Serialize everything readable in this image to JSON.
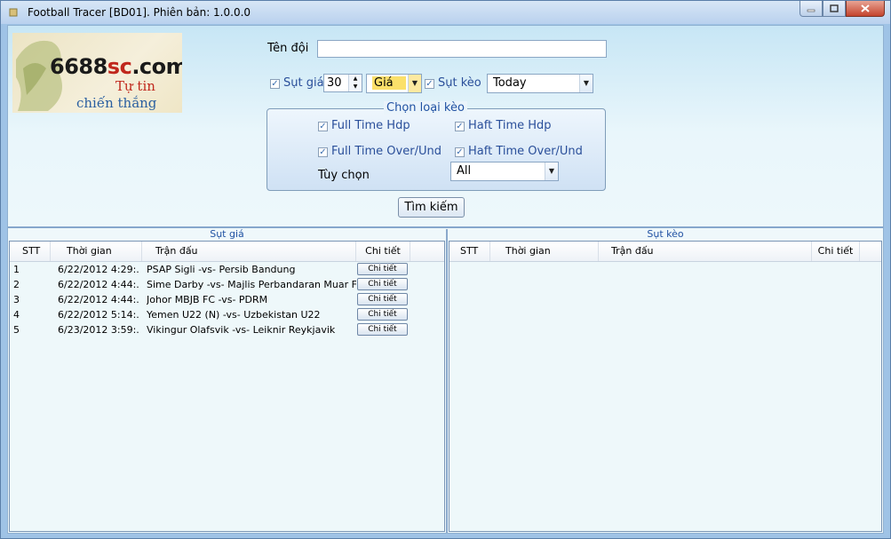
{
  "window": {
    "title": "Football Tracer [BD01]. Phiên bản: 1.0.0.0"
  },
  "logo": {
    "brand_main": "6688",
    "brand_accent": "sc",
    "brand_tail": ".com",
    "slogan_1": "Tự tin",
    "slogan_2": "chiến thắng"
  },
  "search": {
    "team_label": "Tên đội",
    "team_value": "",
    "price_drop": {
      "label": "Sụt giá",
      "checked": true,
      "value": "30",
      "type_value": "Giá"
    },
    "odds_drop": {
      "label": "Sụt kèo",
      "checked": true,
      "period_value": "Today"
    }
  },
  "bet_types": {
    "title": "Chọn loại kèo",
    "full_time_hdp": "Full Time Hdp",
    "half_time_hdp": "Haft Time Hdp",
    "full_time_ou": "Full Time Over/Und",
    "half_time_ou": "Haft Time Over/Und",
    "option_label": "Tùy chọn",
    "option_value": "All"
  },
  "search_button": "Tìm kiếm",
  "left_panel": {
    "title": "Sụt giá",
    "columns": [
      "STT",
      "Thời gian",
      "Trận đấu",
      "Chi tiết"
    ],
    "rows": [
      {
        "stt": "1",
        "time": "6/22/2012 4:29:...",
        "match": "PSAP Sigli -vs- Persib Bandung",
        "detail": "Chi tiết"
      },
      {
        "stt": "2",
        "time": "6/22/2012 4:44:...",
        "match": "Sime Darby -vs- Majlis Perbandaran Muar FC",
        "detail": "Chi tiết"
      },
      {
        "stt": "3",
        "time": "6/22/2012 4:44:...",
        "match": "Johor MBJB FC -vs- PDRM",
        "detail": "Chi tiết"
      },
      {
        "stt": "4",
        "time": "6/22/2012 5:14:...",
        "match": "Yemen U22 (N) -vs- Uzbekistan U22",
        "detail": "Chi tiết"
      },
      {
        "stt": "5",
        "time": "6/23/2012 3:59:...",
        "match": "Vikingur Olafsvik -vs- Leiknir Reykjavik",
        "detail": "Chi tiết"
      }
    ]
  },
  "right_panel": {
    "title": "Sụt kèo",
    "columns": [
      "STT",
      "Thời gian",
      "Trận đấu",
      "Chi tiết"
    ],
    "rows": []
  },
  "icons": {
    "minimize": "minimize-icon",
    "maximize": "maximize-icon",
    "close": "close-icon",
    "dropdown": "chevron-down-icon"
  }
}
